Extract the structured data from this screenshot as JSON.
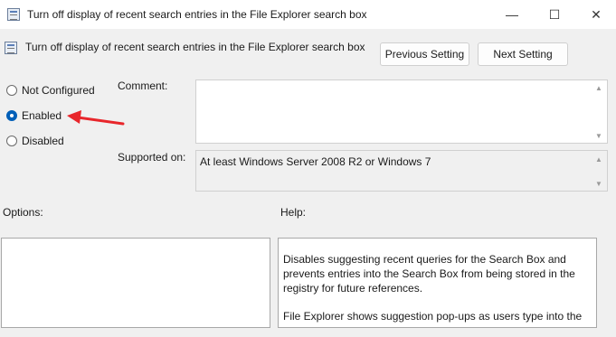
{
  "window": {
    "title": "Turn off display of recent search entries in the File Explorer search box",
    "minimize_glyph": "—",
    "maximize_glyph": "☐",
    "close_glyph": "✕"
  },
  "header": {
    "setting_title": "Turn off display of recent search entries in the File Explorer search box",
    "previous_label": "Previous Setting",
    "next_label": "Next Setting"
  },
  "state": {
    "options": [
      {
        "label": "Not Configured",
        "selected": false
      },
      {
        "label": "Enabled",
        "selected": true
      },
      {
        "label": "Disabled",
        "selected": false
      }
    ]
  },
  "comment": {
    "label": "Comment:",
    "value": ""
  },
  "supported": {
    "label": "Supported on:",
    "value": "At least Windows Server 2008 R2 or Windows 7"
  },
  "options_panel": {
    "label": "Options:"
  },
  "help_panel": {
    "label": "Help:",
    "paragraphs": [
      "Disables suggesting recent queries for the Search Box and prevents entries into the Search Box from being stored in the registry for future references.",
      "File Explorer shows suggestion pop-ups as users type into the"
    ]
  },
  "annotation": {
    "type": "arrow",
    "color": "#e8262b",
    "points_to": "Enabled"
  },
  "colors": {
    "accent": "#005fb8",
    "background": "#f0f0f0"
  },
  "icons": {
    "window": "policy-icon",
    "scroll_up": "scroll-up-icon",
    "scroll_down": "scroll-down-icon"
  }
}
